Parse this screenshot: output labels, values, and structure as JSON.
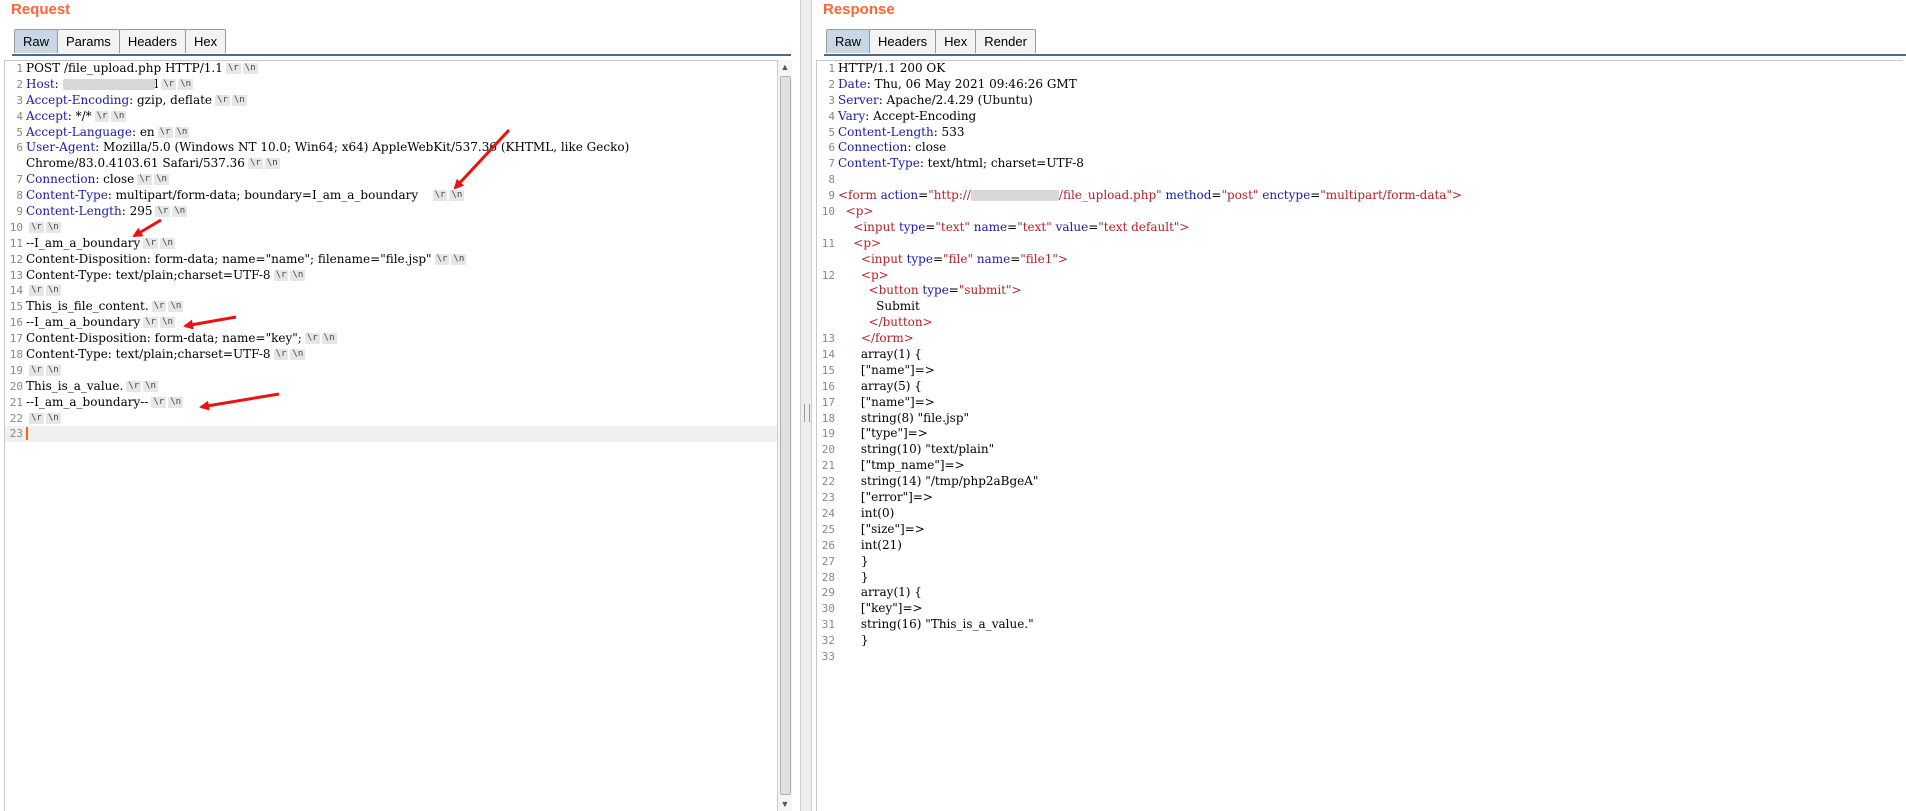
{
  "request": {
    "title": "Request",
    "tabs": [
      "Raw",
      "Params",
      "Headers",
      "Hex"
    ],
    "active_tab": "Raw",
    "crlf_tokens": [
      "\\r",
      "\\n"
    ],
    "lines": [
      {
        "n": "1",
        "name": "",
        "value": "POST /file_upload.php HTTP/1.1",
        "crlf": true
      },
      {
        "n": "2",
        "name": "Host",
        "value": "",
        "masked": true,
        "suffix": "l",
        "crlf": true
      },
      {
        "n": "3",
        "name": "Accept-Encoding",
        "value": "gzip, deflate",
        "crlf": true
      },
      {
        "n": "4",
        "name": "Accept",
        "value": "*/*",
        "crlf": true
      },
      {
        "n": "5",
        "name": "Accept-Language",
        "value": "en",
        "crlf": true
      },
      {
        "n": "6",
        "name": "User-Agent",
        "value": "Mozilla/5.0 (Windows NT 10.0; Win64; x64) AppleWebKit/537.36 (KHTML, like Gecko)",
        "crlf": false
      },
      {
        "n": "",
        "name": "",
        "value": "Chrome/83.0.4103.61 Safari/537.36",
        "crlf": true
      },
      {
        "n": "7",
        "name": "Connection",
        "value": "close",
        "crlf": true
      },
      {
        "n": "8",
        "name": "Content-Type",
        "value": "multipart/form-data; boundary=I_am_a_boundary   ",
        "crlf": true
      },
      {
        "n": "9",
        "name": "Content-Length",
        "value": "295",
        "crlf": true
      },
      {
        "n": "10",
        "name": "",
        "value": "",
        "crlf": true
      },
      {
        "n": "11",
        "name": "",
        "value": "--I_am_a_boundary",
        "crlf": true
      },
      {
        "n": "12",
        "name": "",
        "value": "Content-Disposition: form-data; name=\"name\"; filename=\"file.jsp\"",
        "crlf": true
      },
      {
        "n": "13",
        "name": "",
        "value": "Content-Type: text/plain;charset=UTF-8",
        "crlf": true
      },
      {
        "n": "14",
        "name": "",
        "value": "",
        "crlf": true
      },
      {
        "n": "15",
        "name": "",
        "value": "This_is_file_content.",
        "crlf": true
      },
      {
        "n": "16",
        "name": "",
        "value": "--I_am_a_boundary",
        "crlf": true
      },
      {
        "n": "17",
        "name": "",
        "value": "Content-Disposition: form-data; name=\"key\";",
        "crlf": true
      },
      {
        "n": "18",
        "name": "",
        "value": "Content-Type: text/plain;charset=UTF-8",
        "crlf": true
      },
      {
        "n": "19",
        "name": "",
        "value": "",
        "crlf": true
      },
      {
        "n": "20",
        "name": "",
        "value": "This_is_a_value.",
        "crlf": true
      },
      {
        "n": "21",
        "name": "",
        "value": "--I_am_a_boundary--",
        "crlf": true
      },
      {
        "n": "22",
        "name": "",
        "value": "",
        "crlf": true
      },
      {
        "n": "23",
        "name": "",
        "value": "",
        "crlf": false,
        "cursor": true
      }
    ]
  },
  "response": {
    "title": "Response",
    "tabs": [
      "Raw",
      "Headers",
      "Hex",
      "Render"
    ],
    "active_tab": "Raw",
    "lines": [
      {
        "n": "1",
        "parts": [
          [
            "",
            "HTTP/1.1 200 OK"
          ]
        ]
      },
      {
        "n": "2",
        "parts": [
          [
            "hn",
            "Date"
          ],
          [
            "",
            ": Thu, 06 May 2021 09:46:26 GMT"
          ]
        ]
      },
      {
        "n": "3",
        "parts": [
          [
            "hn",
            "Server"
          ],
          [
            "",
            ": Apache/2.4.29 (Ubuntu)"
          ]
        ]
      },
      {
        "n": "4",
        "parts": [
          [
            "hn",
            "Vary"
          ],
          [
            "",
            ": Accept-Encoding"
          ]
        ]
      },
      {
        "n": "5",
        "parts": [
          [
            "hn",
            "Content-Length"
          ],
          [
            "",
            ": 533"
          ]
        ]
      },
      {
        "n": "6",
        "parts": [
          [
            "hn",
            "Connection"
          ],
          [
            "",
            ": close"
          ]
        ]
      },
      {
        "n": "7",
        "parts": [
          [
            "hn",
            "Content-Type"
          ],
          [
            "",
            ": text/html; charset=UTF-8"
          ]
        ]
      },
      {
        "n": "8",
        "parts": []
      },
      {
        "n": "9",
        "parts": [
          [
            "tag",
            "<form "
          ],
          [
            "attr",
            "action"
          ],
          [
            "",
            "="
          ],
          [
            "val",
            "\"http://"
          ],
          [
            "blur",
            ""
          ],
          [
            "val",
            "/file_upload.php\""
          ],
          [
            "",
            " "
          ],
          [
            "attr",
            "method"
          ],
          [
            "",
            "="
          ],
          [
            "val",
            "\"post\""
          ],
          [
            "",
            " "
          ],
          [
            "attr",
            "enctype"
          ],
          [
            "",
            "="
          ],
          [
            "val",
            "\"multipart/form-data\""
          ],
          [
            "tag",
            ">"
          ]
        ]
      },
      {
        "n": "10",
        "parts": [
          [
            "",
            "  "
          ],
          [
            "tag",
            "<p>"
          ]
        ]
      },
      {
        "n": "",
        "parts": [
          [
            "",
            "    "
          ],
          [
            "tag",
            "<input "
          ],
          [
            "attr",
            "type"
          ],
          [
            "",
            "="
          ],
          [
            "val",
            "\"text\""
          ],
          [
            "",
            " "
          ],
          [
            "attr",
            "name"
          ],
          [
            "",
            "="
          ],
          [
            "val",
            "\"text\""
          ],
          [
            "",
            " "
          ],
          [
            "attr",
            "value"
          ],
          [
            "",
            "="
          ],
          [
            "val",
            "\"text default\""
          ],
          [
            "tag",
            ">"
          ]
        ]
      },
      {
        "n": "11",
        "parts": [
          [
            "",
            "    "
          ],
          [
            "tag",
            "<p>"
          ]
        ]
      },
      {
        "n": "",
        "parts": [
          [
            "",
            "      "
          ],
          [
            "tag",
            "<input "
          ],
          [
            "attr",
            "type"
          ],
          [
            "",
            "="
          ],
          [
            "val",
            "\"file\""
          ],
          [
            "",
            " "
          ],
          [
            "attr",
            "name"
          ],
          [
            "",
            "="
          ],
          [
            "val",
            "\"file1\""
          ],
          [
            "tag",
            ">"
          ]
        ]
      },
      {
        "n": "12",
        "parts": [
          [
            "",
            "      "
          ],
          [
            "tag",
            "<p>"
          ]
        ]
      },
      {
        "n": "",
        "parts": [
          [
            "",
            "        "
          ],
          [
            "tag",
            "<button "
          ],
          [
            "attr",
            "type"
          ],
          [
            "",
            "="
          ],
          [
            "val",
            "\"submit\""
          ],
          [
            "tag",
            ">"
          ]
        ]
      },
      {
        "n": "",
        "parts": [
          [
            "",
            "          Submit"
          ]
        ]
      },
      {
        "n": "",
        "parts": [
          [
            "",
            "        "
          ],
          [
            "tag",
            "</button>"
          ]
        ]
      },
      {
        "n": "13",
        "parts": [
          [
            "",
            "      "
          ],
          [
            "tag",
            "</form>"
          ]
        ]
      },
      {
        "n": "14",
        "parts": [
          [
            "",
            "      array(1) {"
          ]
        ]
      },
      {
        "n": "15",
        "parts": [
          [
            "",
            "      [\"name\"]=>"
          ]
        ]
      },
      {
        "n": "16",
        "parts": [
          [
            "",
            "      array(5) {"
          ]
        ]
      },
      {
        "n": "17",
        "parts": [
          [
            "",
            "      [\"name\"]=>"
          ]
        ]
      },
      {
        "n": "18",
        "parts": [
          [
            "",
            "      string(8) \"file.jsp\""
          ]
        ]
      },
      {
        "n": "19",
        "parts": [
          [
            "",
            "      [\"type\"]=>"
          ]
        ]
      },
      {
        "n": "20",
        "parts": [
          [
            "",
            "      string(10) \"text/plain\""
          ]
        ]
      },
      {
        "n": "21",
        "parts": [
          [
            "",
            "      [\"tmp_name\"]=>"
          ]
        ]
      },
      {
        "n": "22",
        "parts": [
          [
            "",
            "      string(14) \"/tmp/php2aBgeA\""
          ]
        ]
      },
      {
        "n": "23",
        "parts": [
          [
            "",
            "      [\"error\"]=>"
          ]
        ]
      },
      {
        "n": "24",
        "parts": [
          [
            "",
            "      int(0)"
          ]
        ]
      },
      {
        "n": "25",
        "parts": [
          [
            "",
            "      [\"size\"]=>"
          ]
        ]
      },
      {
        "n": "26",
        "parts": [
          [
            "",
            "      int(21)"
          ]
        ]
      },
      {
        "n": "27",
        "parts": [
          [
            "",
            "      }"
          ]
        ]
      },
      {
        "n": "28",
        "parts": [
          [
            "",
            "      }"
          ]
        ]
      },
      {
        "n": "29",
        "parts": [
          [
            "",
            "      array(1) {"
          ]
        ]
      },
      {
        "n": "30",
        "parts": [
          [
            "",
            "      [\"key\"]=>"
          ]
        ]
      },
      {
        "n": "31",
        "parts": [
          [
            "",
            "      string(16) \"This_is_a_value.\""
          ]
        ]
      },
      {
        "n": "32",
        "parts": [
          [
            "",
            "      }"
          ]
        ]
      },
      {
        "n": "33",
        "parts": []
      }
    ]
  },
  "annotation_color": "#ee1111"
}
